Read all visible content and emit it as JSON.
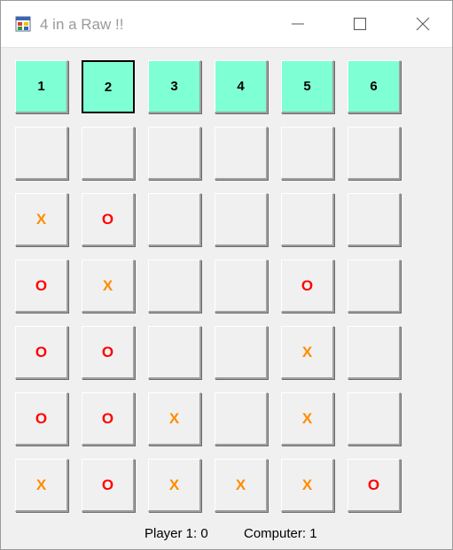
{
  "window": {
    "title": "4 in a Raw !!",
    "icon": "app-window-icon",
    "controls": [
      "minimize-icon",
      "maximize-icon",
      "close-icon"
    ]
  },
  "column_buttons": [
    {
      "label": "1",
      "selected": false
    },
    {
      "label": "2",
      "selected": true
    },
    {
      "label": "3",
      "selected": false
    },
    {
      "label": "4",
      "selected": false
    },
    {
      "label": "5",
      "selected": false
    },
    {
      "label": "6",
      "selected": false
    }
  ],
  "board": [
    [
      "",
      "",
      "",
      "",
      "",
      ""
    ],
    [
      "X",
      "O",
      "",
      "",
      "",
      ""
    ],
    [
      "O",
      "X",
      "",
      "",
      "O",
      ""
    ],
    [
      "O",
      "O",
      "",
      "",
      "X",
      ""
    ],
    [
      "O",
      "O",
      "X",
      "",
      "X",
      ""
    ],
    [
      "X",
      "O",
      "X",
      "X",
      "X",
      "O"
    ]
  ],
  "status": {
    "player_label": "Player 1: 0",
    "computer_label": "Computer: 1"
  },
  "colors": {
    "column_button_bg": "#7fffd4",
    "x_mark": "#ff8c00",
    "o_mark": "#ff0000",
    "form_bg": "#f0f0f0"
  }
}
